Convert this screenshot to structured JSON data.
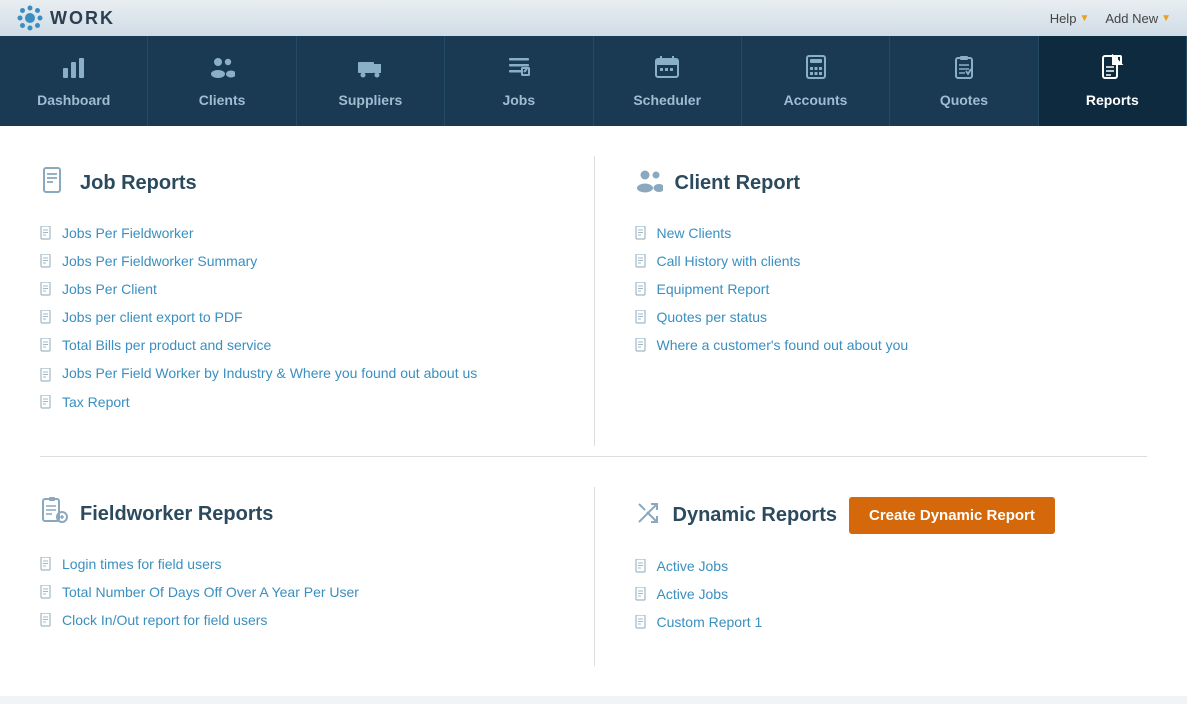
{
  "topbar": {
    "logo_text": "WORK",
    "help_label": "Help",
    "add_new_label": "Add New"
  },
  "nav": {
    "items": [
      {
        "id": "dashboard",
        "label": "Dashboard",
        "icon": "bar-chart"
      },
      {
        "id": "clients",
        "label": "Clients",
        "icon": "people"
      },
      {
        "id": "suppliers",
        "label": "Suppliers",
        "icon": "truck"
      },
      {
        "id": "jobs",
        "label": "Jobs",
        "icon": "list"
      },
      {
        "id": "scheduler",
        "label": "Scheduler",
        "icon": "calendar"
      },
      {
        "id": "accounts",
        "label": "Accounts",
        "icon": "calculator"
      },
      {
        "id": "quotes",
        "label": "Quotes",
        "icon": "clipboard"
      },
      {
        "id": "reports",
        "label": "Reports",
        "icon": "file-text",
        "active": true
      }
    ]
  },
  "job_reports": {
    "title": "Job Reports",
    "items": [
      "Jobs Per Fieldworker",
      "Jobs Per Fieldworker Summary",
      "Jobs Per Client",
      "Jobs per client export to PDF",
      "Total Bills per product and service",
      "Jobs Per Field Worker by Industry & Where you found out about us",
      "Tax Report"
    ]
  },
  "client_reports": {
    "title": "Client Report",
    "items": [
      "New Clients",
      "Call History with clients",
      "Equipment Report",
      "Quotes per status",
      "Where a customer's found out about you"
    ]
  },
  "fieldworker_reports": {
    "title": "Fieldworker Reports",
    "items": [
      "Login times for field users",
      "Total Number Of Days Off Over A Year Per User",
      "Clock In/Out report for field users"
    ]
  },
  "dynamic_reports": {
    "title": "Dynamic Reports",
    "create_button": "Create Dynamic Report",
    "items": [
      "Active Jobs",
      "Active Jobs",
      "Custom Report 1"
    ]
  }
}
